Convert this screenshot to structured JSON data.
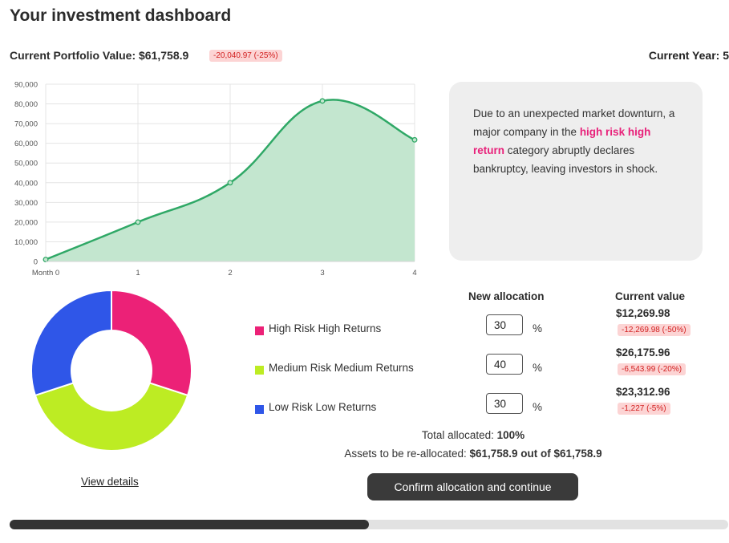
{
  "header": {
    "title": "Your investment dashboard",
    "portfolio_label": "Current Portfolio Value:",
    "portfolio_value": "$61,758.9",
    "portfolio_change": "-20,040.97 (-25%)",
    "year_label": "Current Year:",
    "year_value": "5"
  },
  "chart_data": {
    "type": "area",
    "x": [
      "Month 0",
      "1",
      "2",
      "3",
      "4"
    ],
    "values": [
      1000,
      20000,
      40000,
      81500,
      61759
    ],
    "ylim": [
      0,
      90000
    ],
    "yticks": [
      "90,000",
      "80,000",
      "70,000",
      "60,000",
      "50,000",
      "40,000",
      "30,000",
      "20,000",
      "10,000",
      "0"
    ],
    "grid": true,
    "line_color": "#2fa866",
    "fill_color": "#c3e6cf"
  },
  "event": {
    "text_before": "Due to an unexpected market downturn, a major company in the ",
    "highlight": "high risk high return",
    "text_after": " category abruptly declares bankruptcy, leaving investors in shock."
  },
  "allocation": {
    "head_new": "New allocation",
    "head_current": "Current value",
    "percent_sign": "%",
    "rows": [
      {
        "name": "High Risk High Returns",
        "color": "#ec2177",
        "value": "30",
        "current": "$12,269.98",
        "change": "-12,269.98 (-50%)"
      },
      {
        "name": "Medium Risk Medium Returns",
        "color": "#bdec23",
        "value": "40",
        "current": "$26,175.96",
        "change": "-6,543.99 (-20%)"
      },
      {
        "name": "Low Risk Low Returns",
        "color": "#2f56e8",
        "value": "30",
        "current": "$23,312.96",
        "change": "-1,227 (-5%)"
      }
    ],
    "total_label": "Total allocated:",
    "total_value": "100%",
    "realloc_label": "Assets to be re-allocated:",
    "realloc_value": "$61,758.9 out of $61,758.9"
  },
  "donut": {
    "slices": [
      {
        "name": "High Risk High Returns",
        "value": 30,
        "color": "#ec2177"
      },
      {
        "name": "Medium Risk Medium Returns",
        "value": 40,
        "color": "#bdec23"
      },
      {
        "name": "Low Risk Low Returns",
        "value": 30,
        "color": "#2f56e8"
      }
    ]
  },
  "actions": {
    "view_details": "View details",
    "confirm": "Confirm allocation and continue"
  },
  "progress": {
    "fraction": 0.5
  }
}
